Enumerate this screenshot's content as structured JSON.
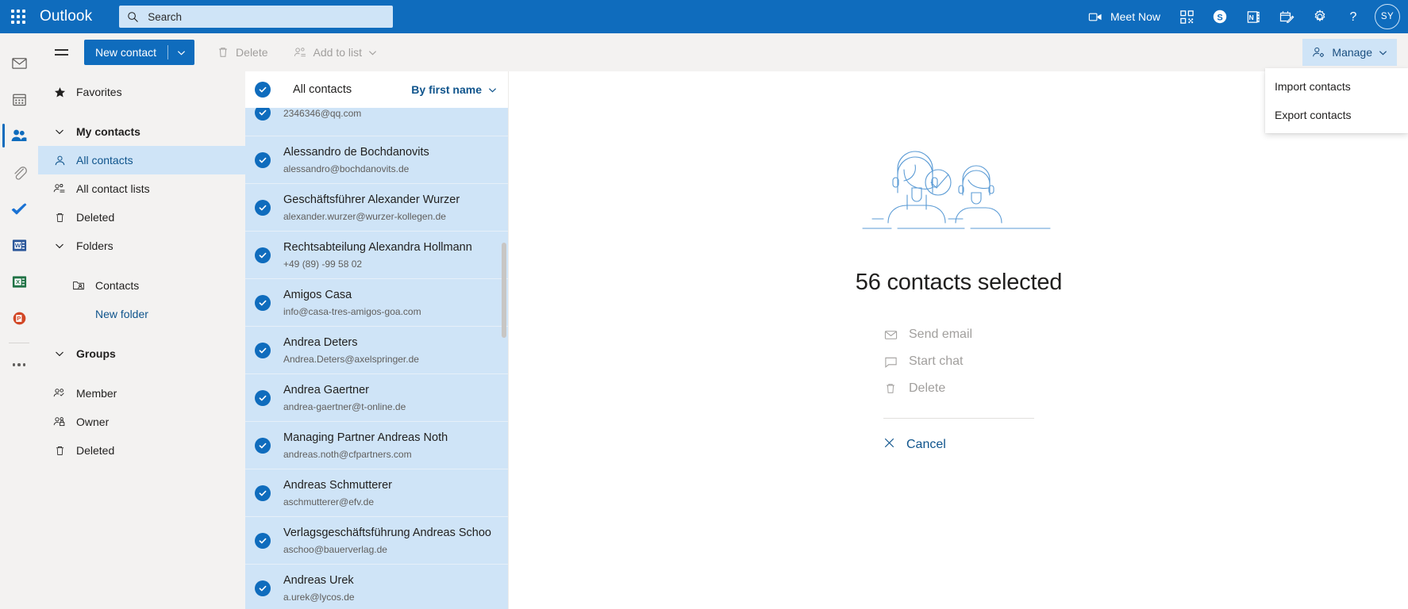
{
  "suite": {
    "brand": "Outlook",
    "waffle_name": "app-launcher",
    "search": {
      "placeholder": "Search",
      "value": ""
    },
    "meet_now": "Meet Now",
    "icons": [
      "qr-code-icon",
      "skype-icon",
      "onenote-icon",
      "calendar-checked-icon",
      "settings-gear-icon",
      "help-icon"
    ],
    "avatar_initials": "SY",
    "accent": "#0f6cbd"
  },
  "commandbar": {
    "new_contact": "New contact",
    "delete": "Delete",
    "add_to_list": "Add to list",
    "manage": "Manage"
  },
  "manage_menu": {
    "open": true,
    "items": [
      {
        "label": "Import contacts"
      },
      {
        "label": "Export contacts"
      }
    ]
  },
  "rail": {
    "items": [
      {
        "name": "mail",
        "icon": "mail-icon",
        "active": false
      },
      {
        "name": "calendar",
        "icon": "calendar-icon",
        "active": false
      },
      {
        "name": "people",
        "icon": "people-icon",
        "active": true
      },
      {
        "name": "files",
        "icon": "paperclip-icon",
        "active": false
      },
      {
        "name": "to-do",
        "icon": "checkmark-icon",
        "active": false
      },
      {
        "name": "word",
        "icon": "word-icon",
        "active": false
      },
      {
        "name": "excel",
        "icon": "excel-icon",
        "active": false
      },
      {
        "name": "powerpoint",
        "icon": "powerpoint-icon",
        "active": false
      },
      {
        "name": "more-apps",
        "icon": "more-dots-icon",
        "active": false
      }
    ]
  },
  "folderpane": {
    "favorites": "Favorites",
    "my_contacts": "My contacts",
    "all_contacts": "All contacts",
    "all_contact_lists": "All contact lists",
    "deleted": "Deleted",
    "folders": "Folders",
    "contacts_folder": "Contacts",
    "new_folder": "New folder",
    "groups": "Groups",
    "member": "Member",
    "owner": "Owner",
    "groups_deleted": "Deleted"
  },
  "list": {
    "title": "All contacts",
    "sort_label": "By first name",
    "select_all_checked": true,
    "contacts": [
      {
        "name": "",
        "sub": "2346346@qq.com",
        "selected": true,
        "partial": true
      },
      {
        "name": "Alessandro de Bochdanovits",
        "sub": "alessandro@bochdanovits.de",
        "selected": true
      },
      {
        "name": "Geschäftsführer Alexander Wurzer",
        "sub": "alexander.wurzer@wurzer-kollegen.de",
        "selected": true
      },
      {
        "name": "Rechtsabteilung Alexandra Hollmann",
        "sub": "+49 (89) -99 58 02",
        "selected": true
      },
      {
        "name": "Amigos Casa",
        "sub": "info@casa-tres-amigos-goa.com",
        "selected": true
      },
      {
        "name": "Andrea Deters",
        "sub": "Andrea.Deters@axelspringer.de",
        "selected": true
      },
      {
        "name": "Andrea Gaertner",
        "sub": "andrea-gaertner@t-online.de",
        "selected": true
      },
      {
        "name": "Managing Partner Andreas Noth",
        "sub": "andreas.noth@cfpartners.com",
        "selected": true
      },
      {
        "name": "Andreas Schmutterer",
        "sub": "aschmutterer@efv.de",
        "selected": true
      },
      {
        "name": "Verlagsgeschäftsführung Andreas Schoo",
        "sub": "aschoo@bauerverlag.de",
        "selected": true
      },
      {
        "name": "Andreas Urek",
        "sub": "a.urek@lycos.de",
        "selected": true
      }
    ]
  },
  "readpane": {
    "selection_title": "56 contacts selected",
    "send_email": "Send email",
    "start_chat": "Start chat",
    "delete": "Delete",
    "cancel": "Cancel"
  }
}
